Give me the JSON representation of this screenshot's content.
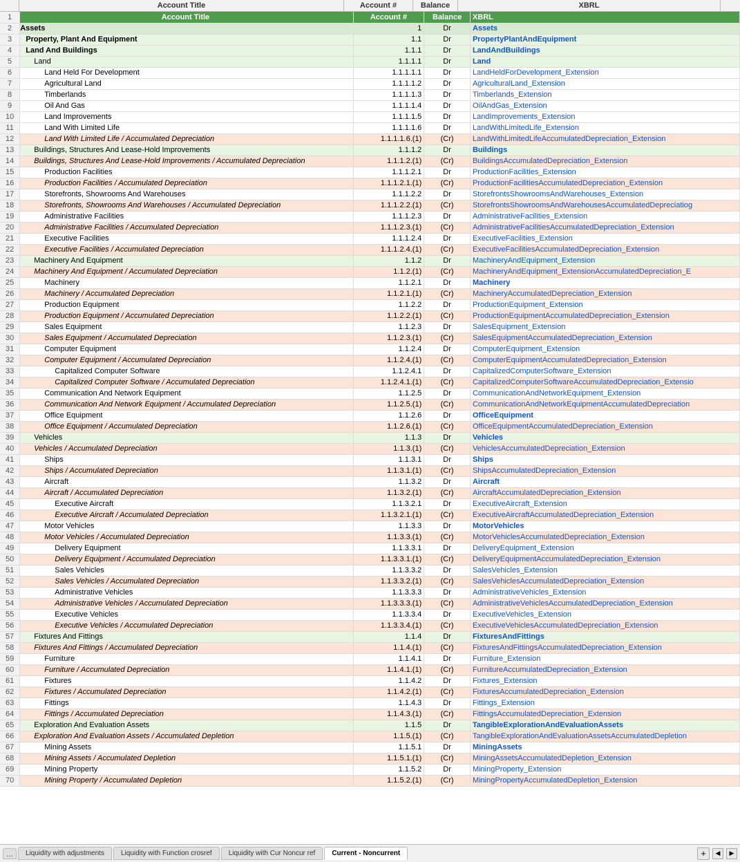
{
  "columns": {
    "rownum": "#",
    "a": "Account Title",
    "b": "Account #",
    "c": "Balance",
    "d": "XBRL"
  },
  "tabs": [
    {
      "label": "...",
      "active": false
    },
    {
      "label": "Liquidity with adjustments",
      "active": false
    },
    {
      "label": "Liquidity with Function crosref",
      "active": false
    },
    {
      "label": "Liquidity with Cur Noncur ref",
      "active": false
    },
    {
      "label": "Current - Noncurrent",
      "active": true
    }
  ],
  "rows": [
    {
      "row": 1,
      "a": "Account Title",
      "b": "Account #",
      "c": "Balance",
      "d": "XBRL",
      "style": "header"
    },
    {
      "row": 2,
      "a": "Assets",
      "b": "1",
      "c": "Dr",
      "d": "Assets",
      "style": "l1"
    },
    {
      "row": 3,
      "a": "Property, Plant And Equipment",
      "b": "1.1",
      "c": "Dr",
      "d": "PropertyPlantAndEquipment",
      "style": "l2"
    },
    {
      "row": 4,
      "a": "Land And Buildings",
      "b": "1.1.1",
      "c": "Dr",
      "d": "LandAndBuildings",
      "style": "l2"
    },
    {
      "row": 5,
      "a": "Land",
      "b": "1.1.1.1",
      "c": "Dr",
      "d": "Land",
      "style": "l3"
    },
    {
      "row": 6,
      "a": "Land Held For Development",
      "b": "1.1.1.1.1",
      "c": "Dr",
      "d": "LandHeldForDevelopment_Extension",
      "style": "l4"
    },
    {
      "row": 7,
      "a": "Agricultural Land",
      "b": "1.1.1.1.2",
      "c": "Dr",
      "d": "AgriculturalLand_Extension",
      "style": "l4"
    },
    {
      "row": 8,
      "a": "Timberlands",
      "b": "1.1.1.1.3",
      "c": "Dr",
      "d": "Timberlands_Extension",
      "style": "l4"
    },
    {
      "row": 9,
      "a": "Oil And Gas",
      "b": "1.1.1.1.4",
      "c": "Dr",
      "d": "OilAndGas_Extension",
      "style": "l4"
    },
    {
      "row": 10,
      "a": "Land Improvements",
      "b": "1.1.1.1.5",
      "c": "Dr",
      "d": "LandImprovements_Extension",
      "style": "l4"
    },
    {
      "row": 11,
      "a": "Land With Limited Life",
      "b": "1.1.1.1.6",
      "c": "Dr",
      "d": "LandWithLimitedLife_Extension",
      "style": "l4"
    },
    {
      "row": 12,
      "a": "Land With Limited Life / Accumulated Depreciation",
      "b": "1.1.1.1.6.(1)",
      "c": "(Cr)",
      "d": "LandWithLimitedLifeAccumulatedDepreciation_Extension",
      "style": "l4b"
    },
    {
      "row": 13,
      "a": "Buildings, Structures And Lease-Hold Improvements",
      "b": "1.1.1.2",
      "c": "Dr",
      "d": "Buildings",
      "style": "l3"
    },
    {
      "row": 14,
      "a": "Buildings, Structures And Lease-Hold Improvements / Accumulated Depreciation",
      "b": "1.1.1.2.(1)",
      "c": "(Cr)",
      "d": "BuildingsAccumulatedDepreciation_Extension",
      "style": "l3b"
    },
    {
      "row": 15,
      "a": "Production Facilities",
      "b": "1.1.1.2.1",
      "c": "Dr",
      "d": "ProductionFacilities_Extension",
      "style": "l4"
    },
    {
      "row": 16,
      "a": "Production Facilities / Accumulated Depreciation",
      "b": "1.1.1.2.1.(1)",
      "c": "(Cr)",
      "d": "ProductionFacilitiesAccumulatedDepreciation_Extension",
      "style": "l4b"
    },
    {
      "row": 17,
      "a": "Storefronts, Showrooms And Warehouses",
      "b": "1.1.1.2.2",
      "c": "Dr",
      "d": "StorefrontsShowroomsAndWarehouses_Extension",
      "style": "l4"
    },
    {
      "row": 18,
      "a": "Storefronts, Showrooms And Warehouses / Accumulated Depreciation",
      "b": "1.1.1.2.2.(1)",
      "c": "(Cr)",
      "d": "StorefrontsShowroomsAndWarehousesAccumulatedDepreciatiog",
      "style": "l4b"
    },
    {
      "row": 19,
      "a": "Administrative Facilities",
      "b": "1.1.1.2.3",
      "c": "Dr",
      "d": "AdministrativeFacilities_Extension",
      "style": "l4"
    },
    {
      "row": 20,
      "a": "Administrative Facilities / Accumulated Depreciation",
      "b": "1.1.1.2.3.(1)",
      "c": "(Cr)",
      "d": "AdministrativeFacilitiesAccumulatedDepreciation_Extension",
      "style": "l4b"
    },
    {
      "row": 21,
      "a": "Executive Facilities",
      "b": "1.1.1.2.4",
      "c": "Dr",
      "d": "ExecutiveFacilities_Extension",
      "style": "l4"
    },
    {
      "row": 22,
      "a": "Executive Facilities / Accumulated Depreciation",
      "b": "1.1.1.2.4.(1)",
      "c": "(Cr)",
      "d": "ExecutiveFacilitiesAccumulatedDepreciation_Extension",
      "style": "l4b"
    },
    {
      "row": 23,
      "a": "Machinery And Equipment",
      "b": "1.1.2",
      "c": "Dr",
      "d": "MachineryAndEquipment_Extension",
      "style": "l3"
    },
    {
      "row": 24,
      "a": "Machinery And Equipment / Accumulated Depreciation",
      "b": "1.1.2.(1)",
      "c": "(Cr)",
      "d": "MachineryAndEquipment_ExtensionAccumulatedDepreciation_E",
      "style": "l3b"
    },
    {
      "row": 25,
      "a": "Machinery",
      "b": "1.1.2.1",
      "c": "Dr",
      "d": "Machinery",
      "style": "l4"
    },
    {
      "row": 26,
      "a": "Machinery / Accumulated Depreciation",
      "b": "1.1.2.1.(1)",
      "c": "(Cr)",
      "d": "MachineryAccumulatedDepreciation_Extension",
      "style": "l4b"
    },
    {
      "row": 27,
      "a": "Production Equipment",
      "b": "1.1.2.2",
      "c": "Dr",
      "d": "ProductionEquipment_Extension",
      "style": "l4"
    },
    {
      "row": 28,
      "a": "Production Equipment / Accumulated Depreciation",
      "b": "1.1.2.2.(1)",
      "c": "(Cr)",
      "d": "ProductionEquipmentAccumulatedDepreciation_Extension",
      "style": "l4b"
    },
    {
      "row": 29,
      "a": "Sales Equipment",
      "b": "1.1.2.3",
      "c": "Dr",
      "d": "SalesEquipment_Extension",
      "style": "l4"
    },
    {
      "row": 30,
      "a": "Sales Equipment / Accumulated Depreciation",
      "b": "1.1.2.3.(1)",
      "c": "(Cr)",
      "d": "SalesEquipmentAccumulatedDepreciation_Extension",
      "style": "l4b"
    },
    {
      "row": 31,
      "a": "Computer Equipment",
      "b": "1.1.2.4",
      "c": "Dr",
      "d": "ComputerEquipment_Extension",
      "style": "l4"
    },
    {
      "row": 32,
      "a": "Computer Equipment / Accumulated Depreciation",
      "b": "1.1.2.4.(1)",
      "c": "(Cr)",
      "d": "ComputerEquipmentAccumulatedDepreciation_Extension",
      "style": "l4b"
    },
    {
      "row": 33,
      "a": "Capitalized Computer Software",
      "b": "1.1.2.4.1",
      "c": "Dr",
      "d": "CapitalizedComputerSoftware_Extension",
      "style": "l5"
    },
    {
      "row": 34,
      "a": "Capitalized Computer Software / Accumulated Depreciation",
      "b": "1.1.2.4.1.(1)",
      "c": "(Cr)",
      "d": "CapitalizedComputerSoftwareAccumulatedDepreciation_Extensio",
      "style": "l5b"
    },
    {
      "row": 35,
      "a": "Communication And Network Equipment",
      "b": "1.1.2.5",
      "c": "Dr",
      "d": "CommunicationAndNetworkEquipment_Extension",
      "style": "l4"
    },
    {
      "row": 36,
      "a": "Communication And Network Equipment / Accumulated Depreciation",
      "b": "1.1.2.5.(1)",
      "c": "(Cr)",
      "d": "CommunicationAndNetworkEquipmentAccumulatedDepreciation",
      "style": "l4b"
    },
    {
      "row": 37,
      "a": "Office Equipment",
      "b": "1.1.2.6",
      "c": "Dr",
      "d": "OfficeEquipment",
      "style": "l4"
    },
    {
      "row": 38,
      "a": "Office Equipment / Accumulated Depreciation",
      "b": "1.1.2.6.(1)",
      "c": "(Cr)",
      "d": "OfficeEquipmentAccumulatedDepreciation_Extension",
      "style": "l4b"
    },
    {
      "row": 39,
      "a": "Vehicles",
      "b": "1.1.3",
      "c": "Dr",
      "d": "Vehicles",
      "style": "l3"
    },
    {
      "row": 40,
      "a": "Vehicles / Accumulated Depreciation",
      "b": "1.1.3.(1)",
      "c": "(Cr)",
      "d": "VehiclesAccumulatedDepreciation_Extension",
      "style": "l3b"
    },
    {
      "row": 41,
      "a": "Ships",
      "b": "1.1.3.1",
      "c": "Dr",
      "d": "Ships",
      "style": "l4"
    },
    {
      "row": 42,
      "a": "Ships / Accumulated Depreciation",
      "b": "1.1.3.1.(1)",
      "c": "(Cr)",
      "d": "ShipsAccumulatedDepreciation_Extension",
      "style": "l4b"
    },
    {
      "row": 43,
      "a": "Aircraft",
      "b": "1.1.3.2",
      "c": "Dr",
      "d": "Aircraft",
      "style": "l4"
    },
    {
      "row": 44,
      "a": "Aircraft / Accumulated Depreciation",
      "b": "1.1.3.2.(1)",
      "c": "(Cr)",
      "d": "AircraftAccumulatedDepreciation_Extension",
      "style": "l4b"
    },
    {
      "row": 45,
      "a": "Executive Aircraft",
      "b": "1.1.3.2.1",
      "c": "Dr",
      "d": "ExecutiveAircraft_Extension",
      "style": "l5"
    },
    {
      "row": 46,
      "a": "Executive Aircraft / Accumulated Depreciation",
      "b": "1.1.3.2.1.(1)",
      "c": "(Cr)",
      "d": "ExecutiveAircraftAccumulatedDepreciation_Extension",
      "style": "l5b"
    },
    {
      "row": 47,
      "a": "Motor Vehicles",
      "b": "1.1.3.3",
      "c": "Dr",
      "d": "MotorVehicles",
      "style": "l4"
    },
    {
      "row": 48,
      "a": "Motor Vehicles / Accumulated Depreciation",
      "b": "1.1.3.3.(1)",
      "c": "(Cr)",
      "d": "MotorVehiclesAccumulatedDepreciation_Extension",
      "style": "l4b"
    },
    {
      "row": 49,
      "a": "Delivery Equipment",
      "b": "1.1.3.3.1",
      "c": "Dr",
      "d": "DeliveryEquipment_Extension",
      "style": "l5"
    },
    {
      "row": 50,
      "a": "Delivery Equipment / Accumulated Depreciation",
      "b": "1.1.3.3.1.(1)",
      "c": "(Cr)",
      "d": "DeliveryEquipmentAccumulatedDepreciation_Extension",
      "style": "l5b"
    },
    {
      "row": 51,
      "a": "Sales Vehicles",
      "b": "1.1.3.3.2",
      "c": "Dr",
      "d": "SalesVehicles_Extension",
      "style": "l5"
    },
    {
      "row": 52,
      "a": "Sales Vehicles / Accumulated Depreciation",
      "b": "1.1.3.3.2.(1)",
      "c": "(Cr)",
      "d": "SalesVehiclesAccumulatedDepreciation_Extension",
      "style": "l5b"
    },
    {
      "row": 53,
      "a": "Administrative Vehicles",
      "b": "1.1.3.3.3",
      "c": "Dr",
      "d": "AdministrativeVehicles_Extension",
      "style": "l5"
    },
    {
      "row": 54,
      "a": "Administrative Vehicles / Accumulated Depreciation",
      "b": "1.1.3.3.3.(1)",
      "c": "(Cr)",
      "d": "AdministrativeVehiclesAccumulatedDepreciation_Extension",
      "style": "l5b"
    },
    {
      "row": 55,
      "a": "Executive Vehicles",
      "b": "1.1.3.3.4",
      "c": "Dr",
      "d": "ExecutiveVehicles_Extension",
      "style": "l5"
    },
    {
      "row": 56,
      "a": "Executive Vehicles / Accumulated Depreciation",
      "b": "1.1.3.3.4.(1)",
      "c": "(Cr)",
      "d": "ExecutiveVehiclesAccumulatedDepreciation_Extension",
      "style": "l5b"
    },
    {
      "row": 57,
      "a": "Fixtures And Fittings",
      "b": "1.1.4",
      "c": "Dr",
      "d": "FixturesAndFittings",
      "style": "l3"
    },
    {
      "row": 58,
      "a": "Fixtures And Fittings / Accumulated Depreciation",
      "b": "1.1.4.(1)",
      "c": "(Cr)",
      "d": "FixturesAndFittingsAccumulatedDepreciation_Extension",
      "style": "l3b"
    },
    {
      "row": 59,
      "a": "Furniture",
      "b": "1.1.4.1",
      "c": "Dr",
      "d": "Furniture_Extension",
      "style": "l4"
    },
    {
      "row": 60,
      "a": "Furniture / Accumulated Depreciation",
      "b": "1.1.4.1.(1)",
      "c": "(Cr)",
      "d": "FurnitureAccumulatedDepreciation_Extension",
      "style": "l4b"
    },
    {
      "row": 61,
      "a": "Fixtures",
      "b": "1.1.4.2",
      "c": "Dr",
      "d": "Fixtures_Extension",
      "style": "l4"
    },
    {
      "row": 62,
      "a": "Fixtures / Accumulated Depreciation",
      "b": "1.1.4.2.(1)",
      "c": "(Cr)",
      "d": "FixturesAccumulatedDepreciation_Extension",
      "style": "l4b"
    },
    {
      "row": 63,
      "a": "Fittings",
      "b": "1.1.4.3",
      "c": "Dr",
      "d": "Fittings_Extension",
      "style": "l4"
    },
    {
      "row": 64,
      "a": "Fittings / Accumulated Depreciation",
      "b": "1.1.4.3.(1)",
      "c": "(Cr)",
      "d": "FittingsAccumulatedDepreciation_Extension",
      "style": "l4b"
    },
    {
      "row": 65,
      "a": "Exploration And Evaluation Assets",
      "b": "1.1.5",
      "c": "Dr",
      "d": "TangibleExplorationAndEvaluationAssets",
      "style": "l3"
    },
    {
      "row": 66,
      "a": "Exploration And Evaluation Assets / Accumulated Depletion",
      "b": "1.1.5.(1)",
      "c": "(Cr)",
      "d": "TangibleExplorationAndEvaluationAssetsAccumulatedDepletion",
      "style": "l3b"
    },
    {
      "row": 67,
      "a": "Mining Assets",
      "b": "1.1.5.1",
      "c": "Dr",
      "d": "MiningAssets",
      "style": "l4"
    },
    {
      "row": 68,
      "a": "Mining Assets / Accumulated Depletion",
      "b": "1.1.5.1.(1)",
      "c": "(Cr)",
      "d": "MiningAssetsAccumulatedDepletion_Extension",
      "style": "l4b"
    },
    {
      "row": 69,
      "a": "Mining Property",
      "b": "1.1.5.2",
      "c": "Dr",
      "d": "MiningProperty_Extension",
      "style": "l4"
    },
    {
      "row": 70,
      "a": "Mining Property / Accumulated Depletion",
      "b": "1.1.5.2.(1)",
      "c": "(Cr)",
      "d": "MiningPropertyAccumulatedDepletion_Extension",
      "style": "l4b"
    }
  ]
}
